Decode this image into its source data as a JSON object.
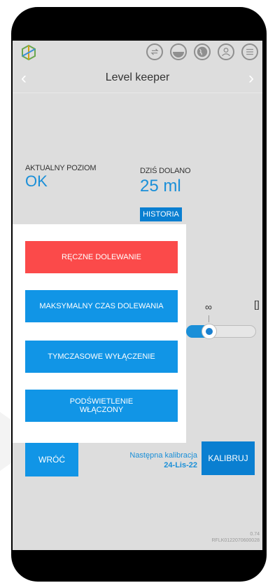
{
  "app": {
    "title": "Level keeper"
  },
  "header_icons": [
    {
      "name": "history-icon"
    },
    {
      "name": "level-icon"
    },
    {
      "name": "globe-icon"
    },
    {
      "name": "user-icon"
    },
    {
      "name": "menu-icon"
    }
  ],
  "status": {
    "current_level_label": "AKTUALNY POZIOM",
    "current_level_value": "OK",
    "today_added_label": "DZIŚ DOLANO",
    "today_added_value": "25 ml",
    "history_button": "HISTORIA"
  },
  "background_controls": {
    "infinity_symbol": "∞",
    "bracket_symbol": "[]"
  },
  "menu": {
    "items": [
      {
        "label": "RĘCZNE DOLEWANIE",
        "color": "#fb4a4a"
      },
      {
        "label": "MAKSYMALNY CZAS DOLEWANIA",
        "color": "#1195e6"
      },
      {
        "label": "TYMCZASOWE WYŁĄCZENIE",
        "color": "#1195e6"
      },
      {
        "label": "PODŚWIETLENIE\nWŁĄCZONY",
        "color": "#1195e6"
      }
    ]
  },
  "footer": {
    "back_button": "WRÓĆ",
    "next_calibration_label": "Następna kalibracja",
    "next_calibration_date": "24-Lis-22",
    "calibrate_button": "KALIBRUJ",
    "version": "0.74",
    "device_id": "RFLK0122070600028"
  },
  "colors": {
    "accent_blue": "#1195e6",
    "dark_blue": "#0a7fd1",
    "alert_red": "#fb4a4a",
    "screen_bg": "#dddddd"
  }
}
